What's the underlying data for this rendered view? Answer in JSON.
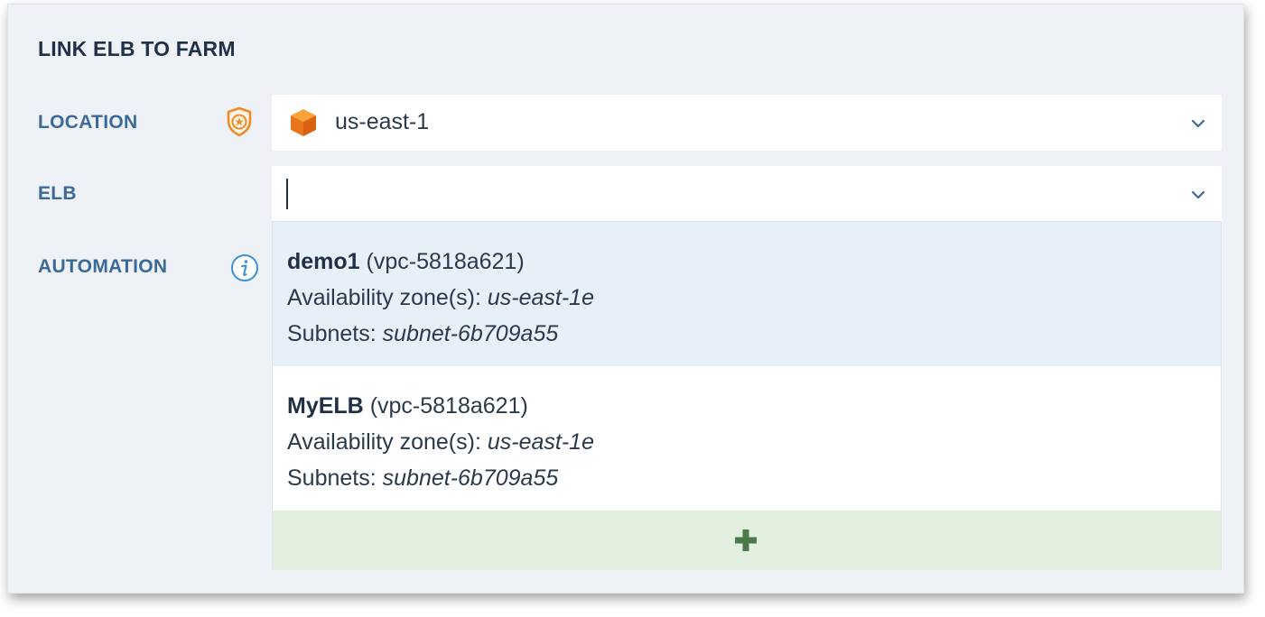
{
  "dialog": {
    "title": "LINK ELB TO FARM"
  },
  "fields": {
    "location": {
      "label": "LOCATION",
      "value": "us-east-1",
      "icon": "policy-shield-icon",
      "value_icon": "region-cube-icon"
    },
    "elb": {
      "label": "ELB",
      "value": ""
    },
    "automation": {
      "label": "AUTOMATION",
      "icon": "info-icon"
    }
  },
  "elb_options": [
    {
      "name": "demo1",
      "vpc": "(vpc-5818a621)",
      "zones_label": "Availability zone(s):",
      "zones": "us-east-1e",
      "subnets_label": "Subnets:",
      "subnets": "subnet-6b709a55",
      "highlighted": true
    },
    {
      "name": "MyELB",
      "vpc": "(vpc-5818a621)",
      "zones_label": "Availability zone(s):",
      "zones": "us-east-1e",
      "subnets_label": "Subnets:",
      "subnets": "subnet-6b709a55",
      "highlighted": false
    }
  ],
  "add_option": {
    "icon": "plus-icon"
  },
  "colors": {
    "panel_bg": "#eef2f6",
    "label": "#3b6a99",
    "highlight_row": "#e7eff8",
    "add_row": "#e3efdf",
    "plus": "#4a7a4a",
    "accent_orange": "#f08a24",
    "info_blue": "#3a8fd6"
  }
}
